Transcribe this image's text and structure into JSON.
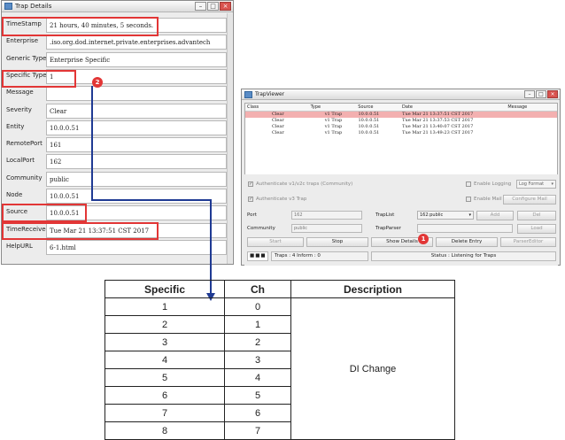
{
  "trap_details": {
    "title": "Trap Details",
    "rows": [
      {
        "label": "TimeStamp",
        "value": "21 hours, 40 minutes, 5 seconds."
      },
      {
        "label": "Enterprise",
        "value": ".iso.org.dod.internet.private.enterprises.advantech"
      },
      {
        "label": "Generic Type",
        "value": "Enterprise Specific"
      },
      {
        "label": "Specific Type",
        "value": "1"
      },
      {
        "label": "Message",
        "value": ""
      },
      {
        "label": "Severity",
        "value": "Clear"
      },
      {
        "label": "Entity",
        "value": "10.0.0.51"
      },
      {
        "label": "RemotePort",
        "value": "161"
      },
      {
        "label": "LocalPort",
        "value": "162"
      },
      {
        "label": "Community",
        "value": "public"
      },
      {
        "label": "Node",
        "value": "10.0.0.51"
      },
      {
        "label": "Source",
        "value": "10.0.0.51"
      },
      {
        "label": "TimeReceived",
        "value": "Tue Mar 21 13:37:51 CST 2017"
      },
      {
        "label": "HelpURL",
        "value": "6-1.html"
      }
    ],
    "badge": "2"
  },
  "trap_viewer": {
    "title": "TrapViewer",
    "columns": [
      "Class",
      "Type",
      "Source",
      "Date",
      "Message"
    ],
    "rows": [
      [
        "Clear",
        "v1 Trap",
        "10.0.0.51",
        "Tue Mar 21 13:37:51 CST 2017",
        ""
      ],
      [
        "Clear",
        "v1 Trap",
        "10.0.0.51",
        "Tue Mar 21 13:37:53 CST 2017",
        ""
      ],
      [
        "Clear",
        "v1 Trap",
        "10.0.0.51",
        "Tue Mar 21 13:40:07 CST 2017",
        ""
      ],
      [
        "Clear",
        "v1 Trap",
        "10.0.0.51",
        "Tue Mar 21 13:49:23 CST 2017",
        ""
      ]
    ],
    "auth_v1v2": "Authenticate v1/v2c traps (Community)",
    "auth_v3": "Authenticate v3 Trap",
    "enable_logging": "Enable Logging",
    "log_format": "Log Format",
    "enable_mail": "Enable Mail",
    "configure_mail": "Configure Mail",
    "port_label": "Port",
    "port_value": "162",
    "traplist_label": "TrapList",
    "traplist_value": "162:public",
    "add": "Add",
    "del": "Del",
    "community_label": "Community",
    "community_value": "public",
    "trapparser_label": "TrapParser",
    "load": "Load",
    "start": "Start",
    "stop": "Stop",
    "show_details": "Show Details",
    "delete_entry": "Delete Entry",
    "parser_editor": "ParserEditor",
    "traps_count": "Traps : 4 Inform : 0",
    "status": "Status : Listening for Traps",
    "badge": "1"
  },
  "mapping_table": {
    "headers": [
      "Specific",
      "Ch",
      "Description"
    ],
    "rows": [
      [
        "1",
        "0"
      ],
      [
        "2",
        "1"
      ],
      [
        "3",
        "2"
      ],
      [
        "4",
        "3"
      ],
      [
        "5",
        "4"
      ],
      [
        "6",
        "5"
      ],
      [
        "7",
        "6"
      ],
      [
        "8",
        "7"
      ]
    ],
    "description": "DI Change"
  },
  "colors": {
    "highlight": "#e23636",
    "arrow": "#1f3a93",
    "selected_row": "#f3b0b0"
  }
}
